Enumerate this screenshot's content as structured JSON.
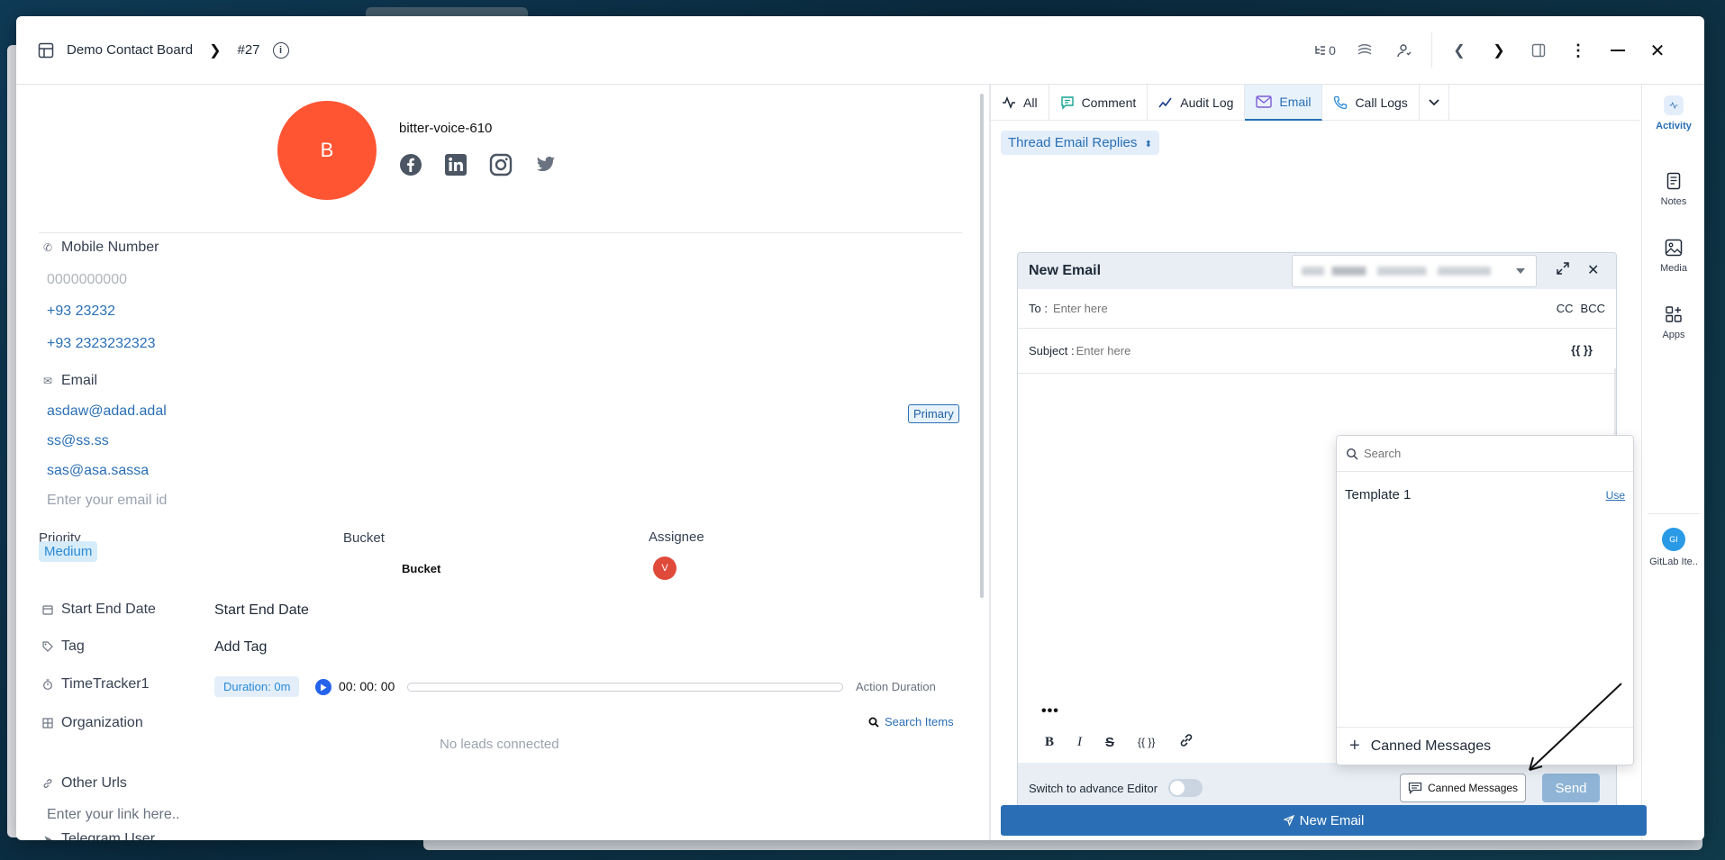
{
  "header": {
    "board_name": "Demo Contact Board",
    "record_id": "#27",
    "subtask_count": "0"
  },
  "contact": {
    "avatar_letter": "B",
    "name": "bitter-voice-610"
  },
  "fields": {
    "mobile_label": "Mobile Number",
    "mobile_placeholder": "0000000000",
    "mobiles": [
      "+93 23232",
      "+93 2323232323"
    ],
    "email_label": "Email",
    "emails": [
      "asdaw@adad.adal",
      "ss@ss.ss",
      "sas@asa.sassa"
    ],
    "primary_badge": "Primary",
    "email_placeholder": "Enter your email id",
    "priority_label": "Priority",
    "priority_value": "Medium",
    "bucket_label": "Bucket",
    "bucket_value": "Bucket",
    "assignee_label": "Assignee",
    "assignee_initial": "V",
    "date_label": "Start End Date",
    "date_value": "Start End Date",
    "tag_label": "Tag",
    "tag_value": "Add Tag",
    "timetracker_label": "TimeTracker1",
    "duration": "Duration: 0m",
    "timer": "00: 00: 00",
    "action_duration": "Action Duration",
    "organization_label": "Organization",
    "search_items": "Search Items",
    "no_leads": "No leads connected",
    "urls_label": "Other Urls",
    "urls_placeholder": "Enter your link here..",
    "telegram_label": "Telegram User"
  },
  "tabs": [
    {
      "label": "All",
      "icon": "activity-icon"
    },
    {
      "label": "Comment",
      "icon": "comment-icon"
    },
    {
      "label": "Audit Log",
      "icon": "chart-line-icon"
    },
    {
      "label": "Email",
      "icon": "mail-icon"
    },
    {
      "label": "Call Logs",
      "icon": "phone-icon"
    }
  ],
  "thread_button": "Thread Email Replies",
  "rail": {
    "activity": "Activity",
    "notes": "Notes",
    "media": "Media",
    "apps": "Apps",
    "gitlab_initials": "GI",
    "gitlab": "GitLab Ite.."
  },
  "composer": {
    "title": "New Email",
    "to_label": "To :",
    "to_placeholder": "Enter here",
    "cc": "CC",
    "bcc": "BCC",
    "subject_label": "Subject :",
    "subject_placeholder": "Enter here",
    "braces": "{{ }}",
    "more": "•••",
    "switch_label": "Switch to advance Editor",
    "canned_button": "Canned Messages",
    "send": "Send"
  },
  "canned": {
    "search_placeholder": "Search",
    "template": "Template 1",
    "use": "Use",
    "footer": "Canned Messages"
  },
  "new_email_button": "New Email",
  "colors": {
    "accent": "#2a6fb5",
    "avatar": "#ff5533"
  }
}
